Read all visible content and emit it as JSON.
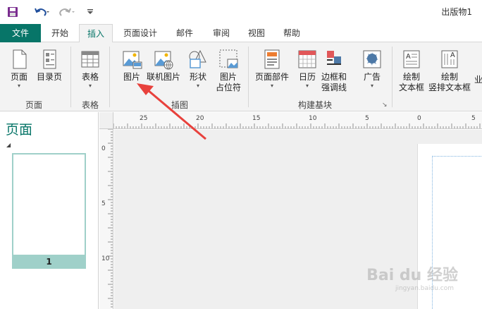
{
  "window": {
    "title": "出版物1"
  },
  "qat": {
    "save_icon": "save-icon",
    "undo_icon": "undo-icon",
    "redo_icon": "redo-icon",
    "customize_icon": "customize-qat-icon"
  },
  "tabs": [
    {
      "label": "文件"
    },
    {
      "label": "开始"
    },
    {
      "label": "插入"
    },
    {
      "label": "页面设计"
    },
    {
      "label": "邮件"
    },
    {
      "label": "审阅"
    },
    {
      "label": "视图"
    },
    {
      "label": "帮助"
    }
  ],
  "ribbon": {
    "pages": {
      "page": "页面",
      "catalog": "目录页",
      "group": "页面"
    },
    "tables": {
      "table": "表格",
      "group": "表格"
    },
    "illustrations": {
      "picture": "图片",
      "online_picture": "联机图片",
      "shapes": "形状",
      "placeholder_line1": "图片",
      "placeholder_line2": "占位符",
      "group": "插图"
    },
    "blocks": {
      "page_parts": "页面部件",
      "calendar": "日历",
      "borders_line1": "边框和",
      "borders_line2": "强调线",
      "ads": "广告",
      "group": "构建基块"
    },
    "text": {
      "draw_textbox_line1": "绘制",
      "draw_textbox_line2": "文本框",
      "vertical_textbox_line1": "绘制",
      "vertical_textbox_line2": "竖排文本框",
      "cut_label": "业"
    }
  },
  "pages_panel": {
    "title": "页面",
    "thumb_number": "1"
  },
  "hruler": {
    "labels": [
      "25",
      "20",
      "15",
      "10",
      "5",
      "0",
      "5"
    ]
  },
  "vruler": {
    "labels": [
      "0",
      "5",
      "10"
    ]
  },
  "watermark": {
    "main": "Bai du 经验",
    "sub": "jingyan.baidu.com"
  }
}
